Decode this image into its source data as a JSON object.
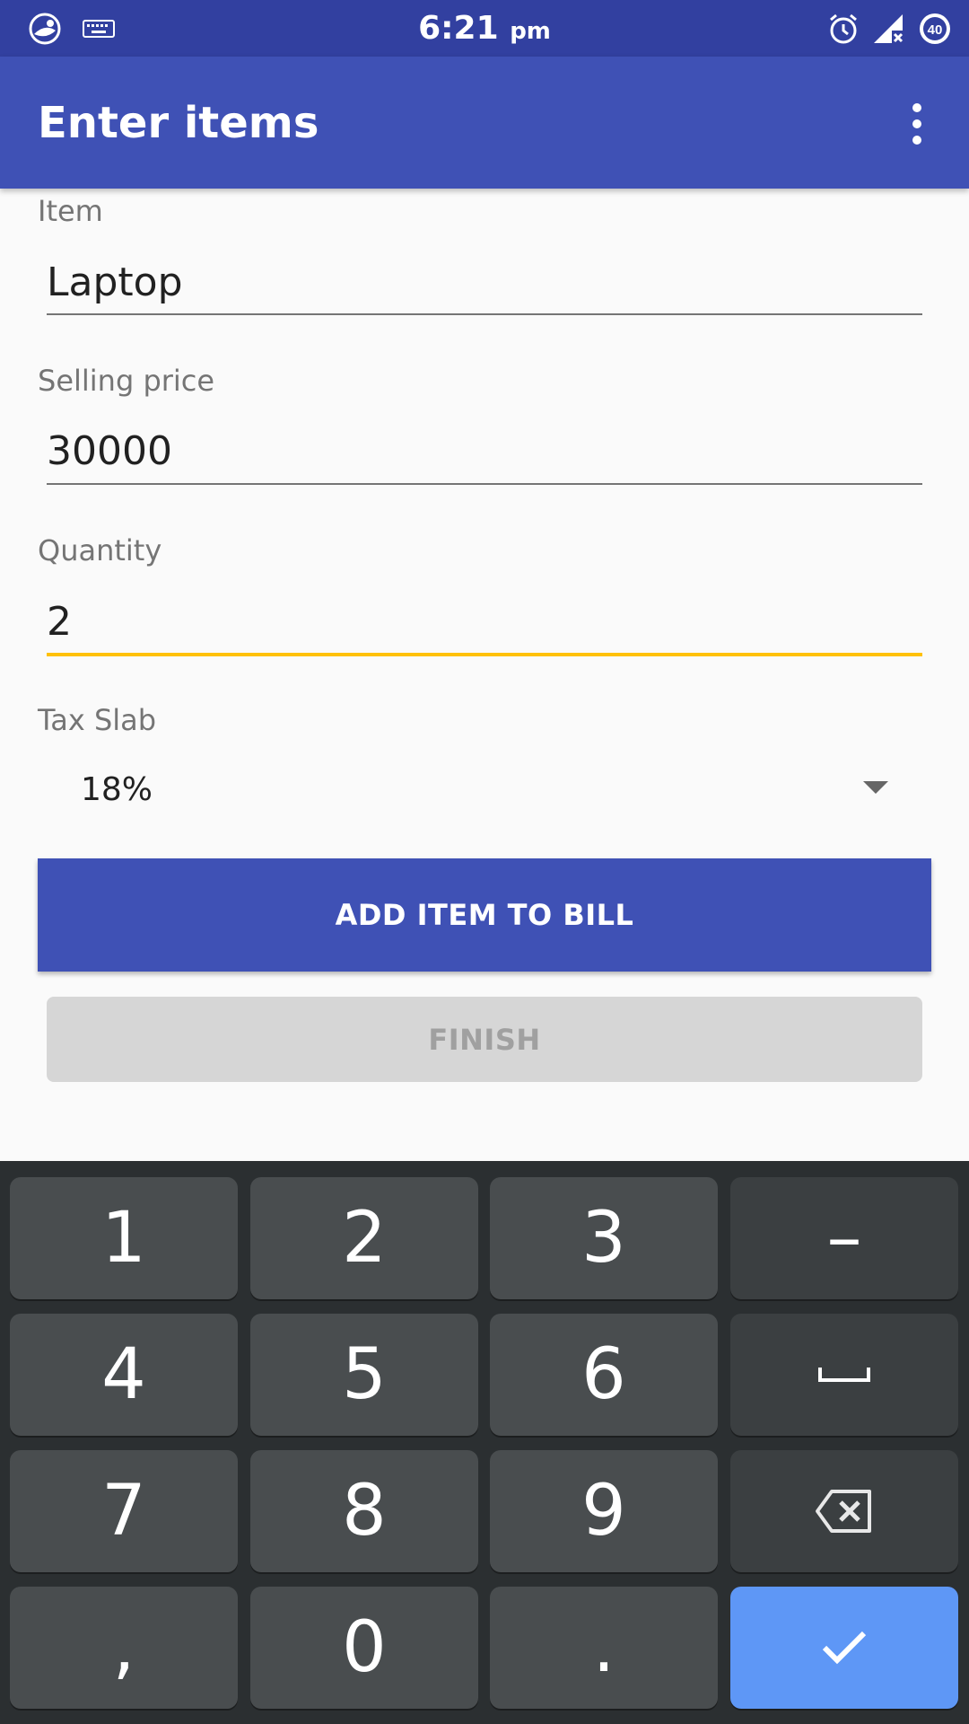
{
  "status_bar": {
    "time": "6:21",
    "ampm": "pm",
    "battery_level": "40",
    "icons": [
      "app-notification-icon",
      "keyboard-icon",
      "alarm-icon",
      "signal-no-data-icon",
      "battery-icon"
    ]
  },
  "app_bar": {
    "title": "Enter items",
    "menu_icon": "overflow-menu-icon"
  },
  "form": {
    "item": {
      "label": "Item",
      "value": "Laptop"
    },
    "selling_price": {
      "label": "Selling price",
      "value": "30000"
    },
    "quantity": {
      "label": "Quantity",
      "value": "2"
    },
    "tax_slab": {
      "label": "Tax Slab",
      "selected": "18%"
    }
  },
  "buttons": {
    "add_item": "ADD ITEM TO BILL",
    "finish": "FINISH"
  },
  "keyboard": {
    "rows": [
      [
        "1",
        "2",
        "3",
        "–"
      ],
      [
        "4",
        "5",
        "6",
        "space"
      ],
      [
        "7",
        "8",
        "9",
        "backspace"
      ],
      [
        ",",
        "0",
        ".",
        "done"
      ]
    ]
  },
  "colors": {
    "status_bar": "#3240a0",
    "primary": "#3f51b5",
    "accent": "#ffc107",
    "keyboard_bg": "#2b2f31",
    "key": "#494d4f",
    "key_func": "#3b3f41",
    "enter_key": "#5e97f6"
  }
}
